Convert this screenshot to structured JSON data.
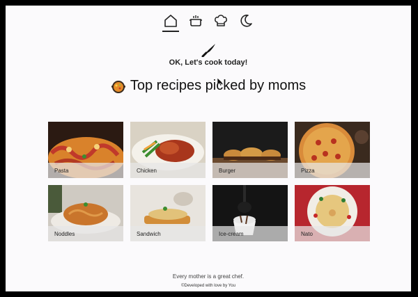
{
  "nav": {
    "items": [
      {
        "icon": "home-icon"
      },
      {
        "icon": "cooking-pot-icon"
      },
      {
        "icon": "chef-hat-icon"
      },
      {
        "icon": "moon-icon"
      }
    ]
  },
  "hero": {
    "icon": "knife-icon",
    "tagline": "OK, Let's cook today!"
  },
  "section": {
    "icon": "pot-emoji-icon",
    "title": "Top recipes picked by moms"
  },
  "recipes": [
    {
      "label": "Pasta"
    },
    {
      "label": "Chicken"
    },
    {
      "label": "Burger"
    },
    {
      "label": "Pizza"
    },
    {
      "label": "Noddles"
    },
    {
      "label": "Sandwich"
    },
    {
      "label": "Ice-cream"
    },
    {
      "label": "Nato"
    }
  ],
  "footer": {
    "quote": "Every mother is a great chef.",
    "credit": "©Developed with love by You"
  }
}
